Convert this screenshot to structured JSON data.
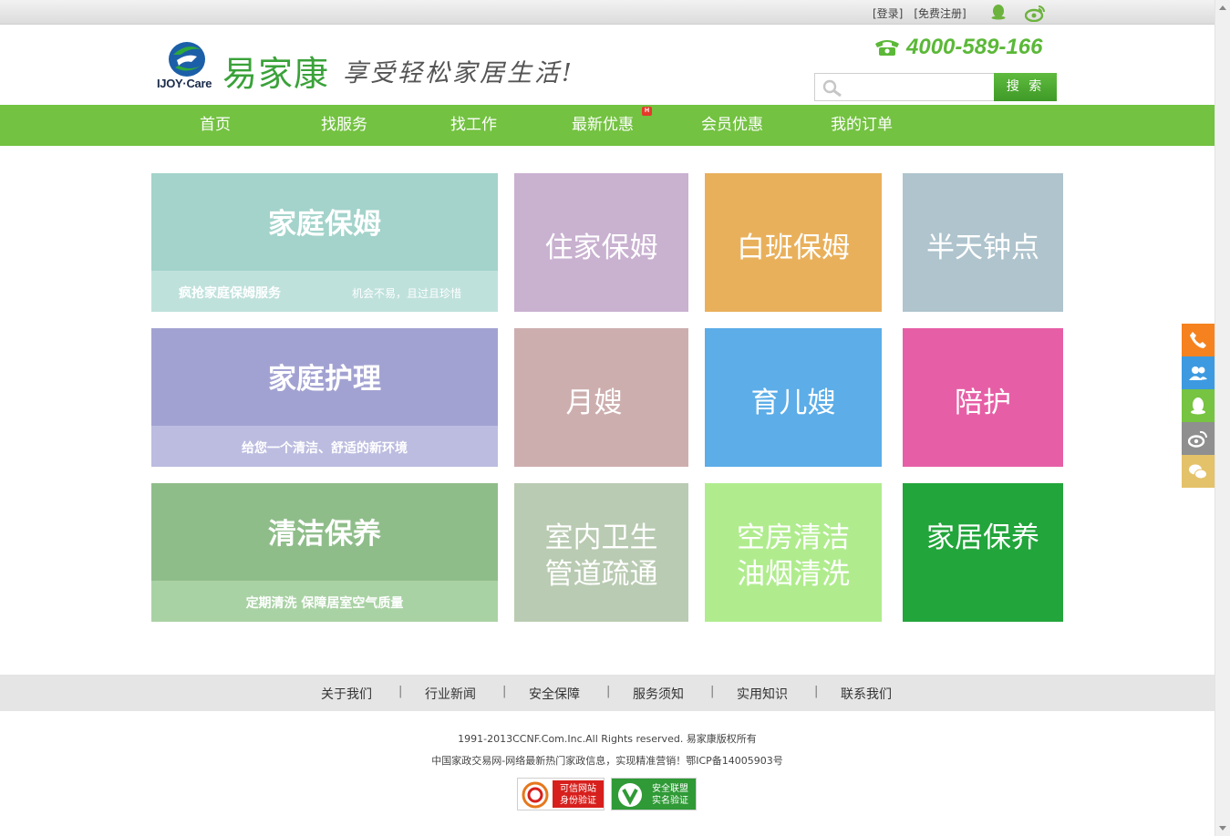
{
  "topbar": {
    "login": "[登录]",
    "register": "[免费注册]"
  },
  "header": {
    "logo_en": "IJOY·Care",
    "logo_cn": "易家康",
    "slogan": "享受轻松家居生活!",
    "phone": "4000-589-166",
    "search_placeholder": "",
    "search_button": "搜 索"
  },
  "nav": {
    "items": [
      "首页",
      "找服务",
      "找工作",
      "最新优惠",
      "会员优惠",
      "我的订单"
    ],
    "hot_badge": "H"
  },
  "tiles": {
    "family_nanny": {
      "title": "家庭保姆",
      "sub_left": "疯抢家庭保姆服务",
      "sub_right": "机会不易，且过且珍惜",
      "color": "#a3d3cb",
      "sub_color": "#bfe1dc"
    },
    "live_in_nanny": {
      "label": "住家保姆",
      "color": "#c9b1d0"
    },
    "day_nanny": {
      "label": "白班保姆",
      "color": "#e9b05b"
    },
    "half_day": {
      "label": "半天钟点",
      "color": "#afc4cd"
    },
    "family_care": {
      "title": "家庭护理",
      "sub": "给您一个清洁、舒适的新环境",
      "color": "#a2a2d2",
      "sub_color": "#bcbce0"
    },
    "maternity": {
      "label": "月嫂",
      "color": "#cdaeae"
    },
    "childcare": {
      "label": "育儿嫂",
      "color": "#5cade8"
    },
    "escort": {
      "label": "陪护",
      "color": "#e65fa6"
    },
    "cleaning": {
      "title": "清洁保养",
      "sub": "定期清洗 保障居室空气质量",
      "color": "#8fbd8a",
      "sub_color": "#a9d2a4"
    },
    "indoor": {
      "line1": "室内卫生",
      "line2": "管道疏通",
      "color": "#b9cbb2"
    },
    "vacant": {
      "line1": "空房清洁",
      "line2": "油烟清洗",
      "color": "#b0ec8e"
    },
    "home_care": {
      "label": "家居保养",
      "color": "#22a53b"
    }
  },
  "side_buttons": [
    {
      "icon": "phone-icon",
      "color": "#f5821f"
    },
    {
      "icon": "users-icon",
      "color": "#3d9ae0"
    },
    {
      "icon": "qq-icon",
      "color": "#76c441"
    },
    {
      "icon": "weibo-icon",
      "color": "#8f8f8f"
    },
    {
      "icon": "wechat-icon",
      "color": "#e4c26a"
    }
  ],
  "footer": {
    "links": [
      "关于我们",
      "行业新闻",
      "安全保障",
      "服务须知",
      "实用知识",
      "联系我们"
    ],
    "separator": "|",
    "copyright": "1991-2013CCNF.Com.Inc.All Rights reserved. 易家康版权所有",
    "icp": "中国家政交易网-网络最新热门家政信息，实现精准营销！鄂ICP备14005903号",
    "badge1_line1": "可信网站",
    "badge1_line2": "身份验证",
    "badge2_line1": "安全联盟",
    "badge2_line2": "实名验证"
  }
}
